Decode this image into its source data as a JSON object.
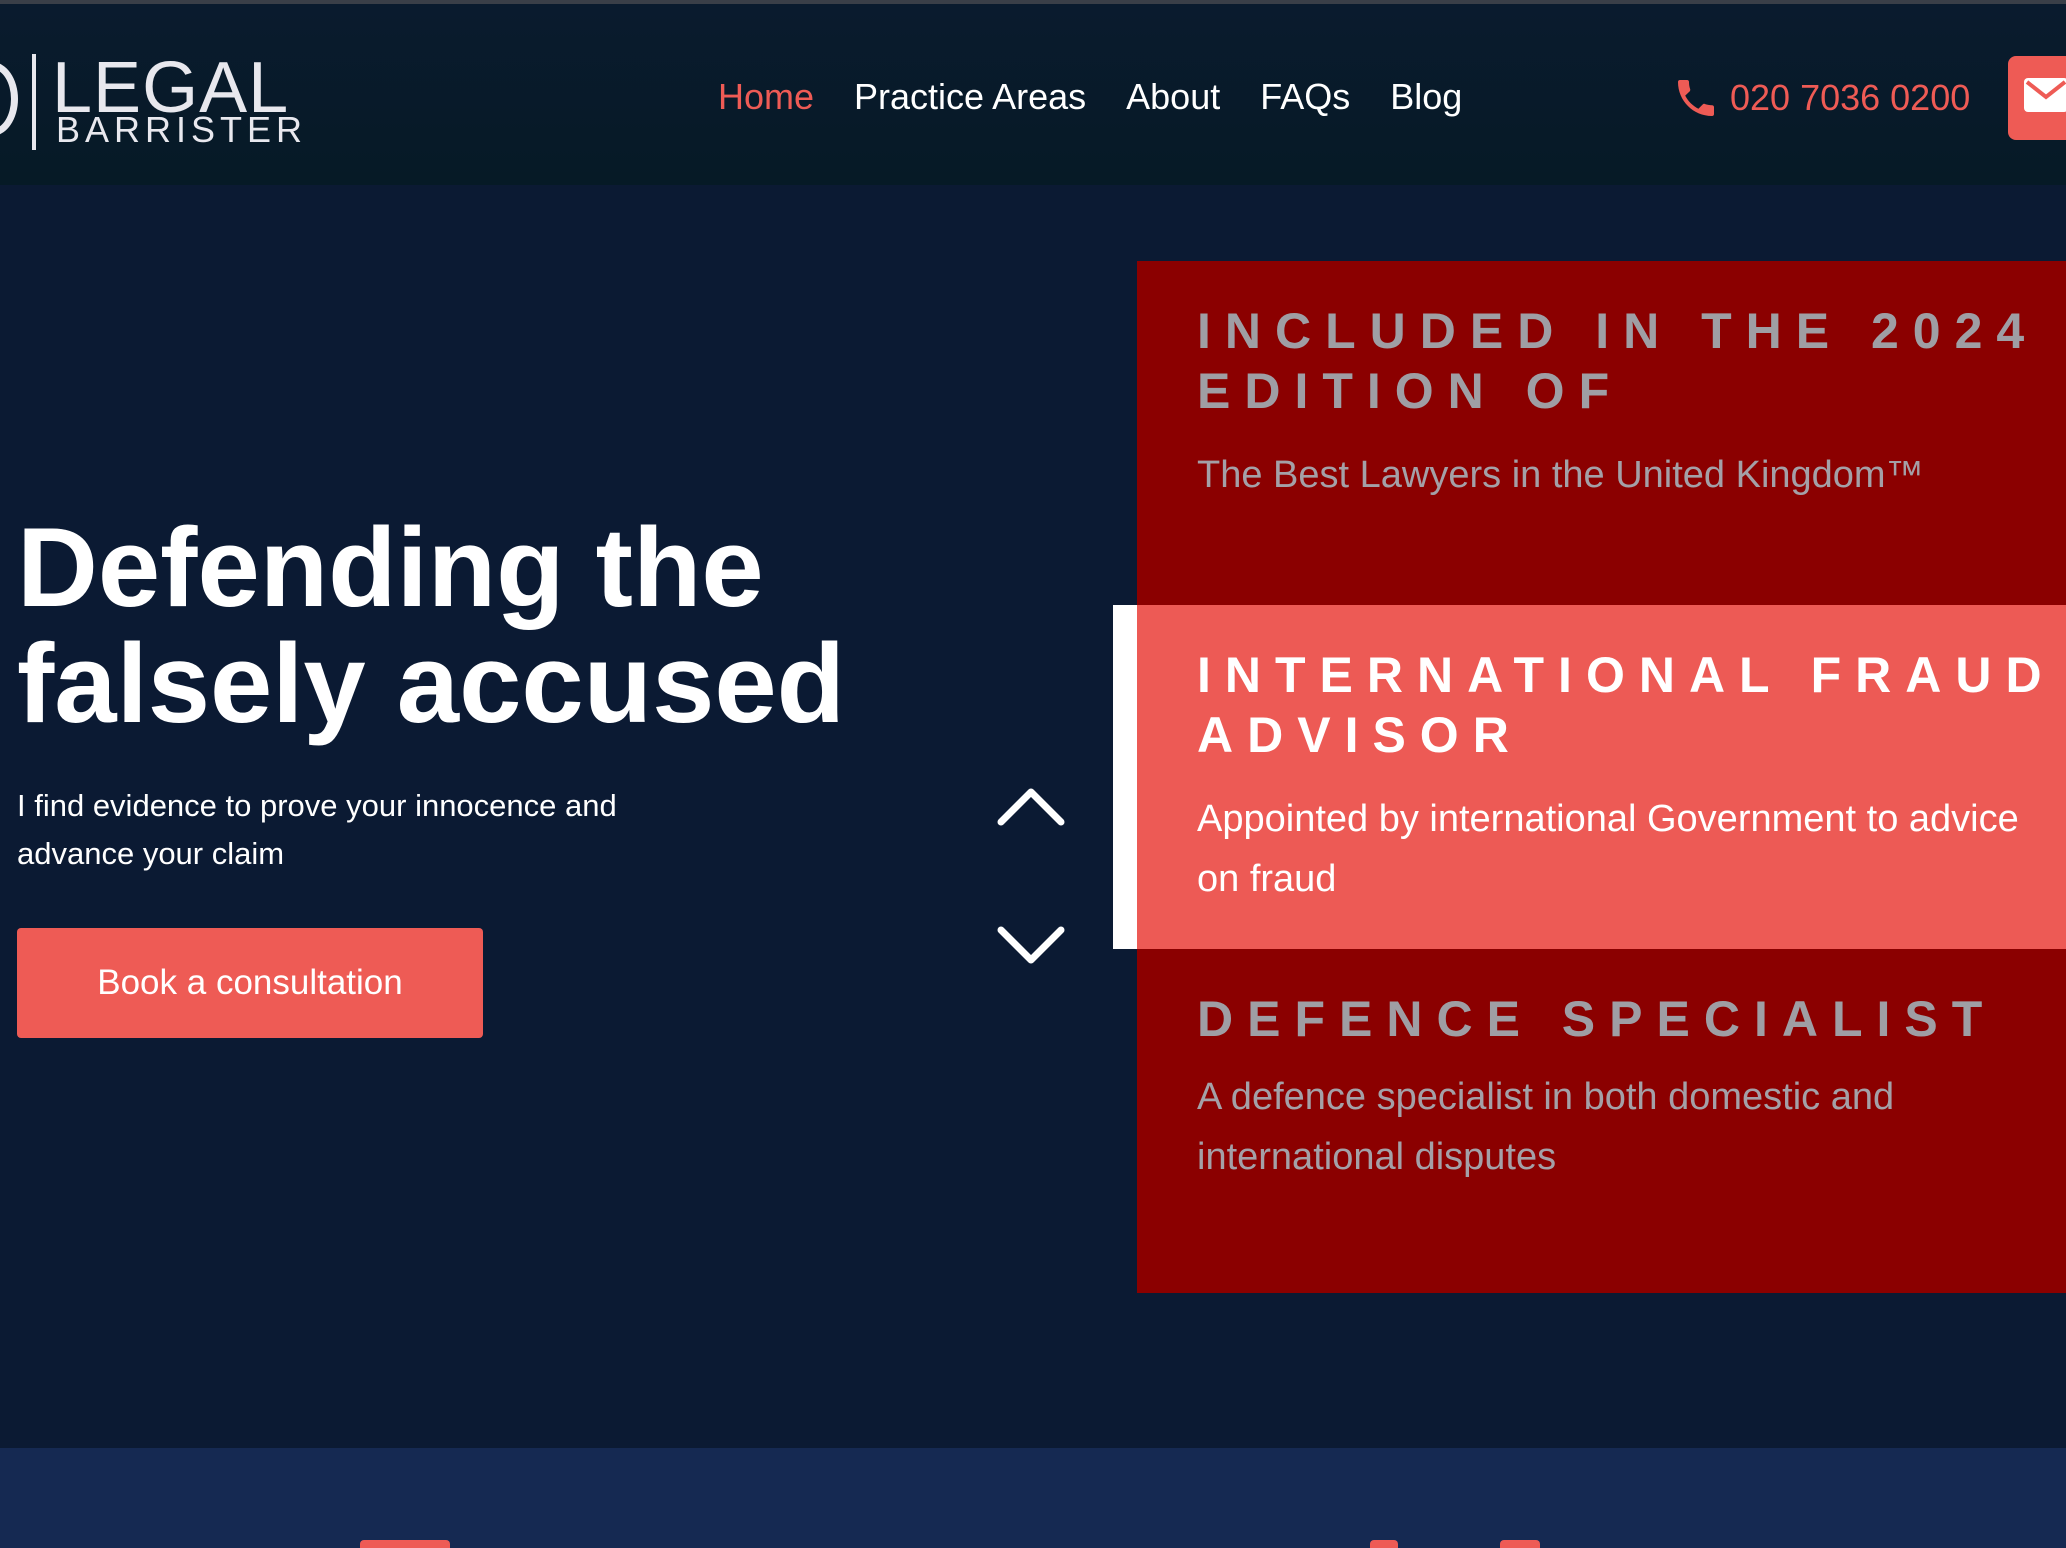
{
  "header": {
    "logo": {
      "word_1": "LEGAL",
      "word_2": "BARRISTER"
    },
    "nav": [
      {
        "label": "Home",
        "active": true
      },
      {
        "label": "Practice Areas",
        "active": false
      },
      {
        "label": "About",
        "active": false
      },
      {
        "label": "FAQs",
        "active": false
      },
      {
        "label": "Blog",
        "active": false
      }
    ],
    "phone": {
      "number": "020 7036 0200",
      "icon": "phone-icon"
    },
    "mail_button": {
      "icon": "mail-icon"
    }
  },
  "hero": {
    "title_line_1": "Defending the",
    "title_line_2": "falsely accused",
    "subtitle_line_1": "I find evidence to prove your innocence and",
    "subtitle_line_2": "advance your claim",
    "cta_label": "Book a consultation"
  },
  "carousel": {
    "up_icon": "chevron-up-icon",
    "down_icon": "chevron-down-icon",
    "active_index": 1,
    "cards": [
      {
        "title": "Included in the 2024 edition of",
        "text": "The Best Lawyers in the United Kingdom™"
      },
      {
        "title": "International Fraud Advisor",
        "text": "Appointed by international Government to advice on fraud"
      },
      {
        "title": "Defence Specialist",
        "text": "A defence specialist in both domestic and international disputes"
      }
    ]
  },
  "colors": {
    "accent": "#ee5b55",
    "background": "#0b1a33",
    "card_dark": "#8b0000",
    "section_blue": "#152952"
  }
}
